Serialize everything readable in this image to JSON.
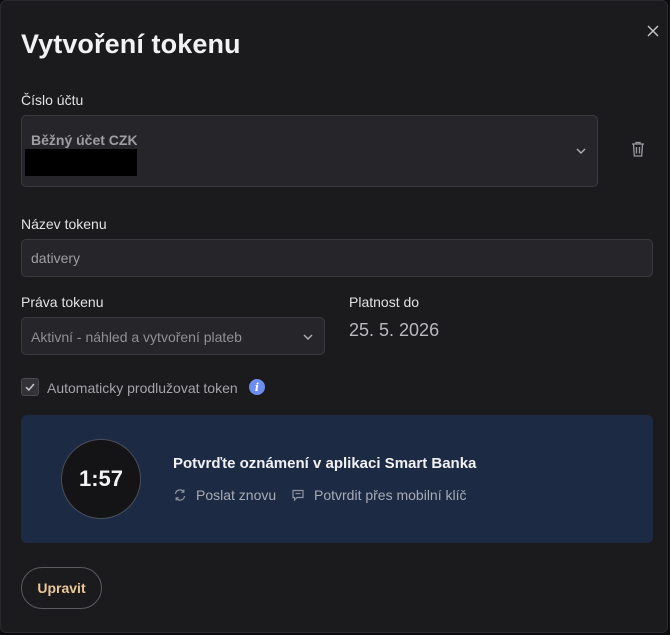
{
  "dialog": {
    "title": "Vytvoření tokenu",
    "close_icon": "close-icon"
  },
  "account": {
    "label": "Číslo účtu",
    "name": "Běžný účet CZK",
    "number_redacted": true,
    "chevron_icon": "chevron-down-icon",
    "delete_icon": "trash-icon"
  },
  "token_name": {
    "label": "Název tokenu",
    "value": "dativery"
  },
  "rights": {
    "label": "Práva tokenu",
    "value": "Aktivní - náhled a vytvoření plateb"
  },
  "validity": {
    "label": "Platnost do",
    "value": "25. 5. 2026"
  },
  "auto_extend": {
    "label": "Automaticky prodlužovat token",
    "checked": true,
    "info_icon": "info-icon",
    "info_color": "#6e8df0"
  },
  "confirmation": {
    "timer": "1:57",
    "title": "Potvrďte oznámení v aplikaci Smart Banka",
    "resend_label": "Poslat znovu",
    "mobile_key_label": "Potvrdit přes mobilní klíč",
    "panel_color": "#1d2a44"
  },
  "footer": {
    "edit_label": "Upravit",
    "edit_color": "#e9c79a"
  }
}
